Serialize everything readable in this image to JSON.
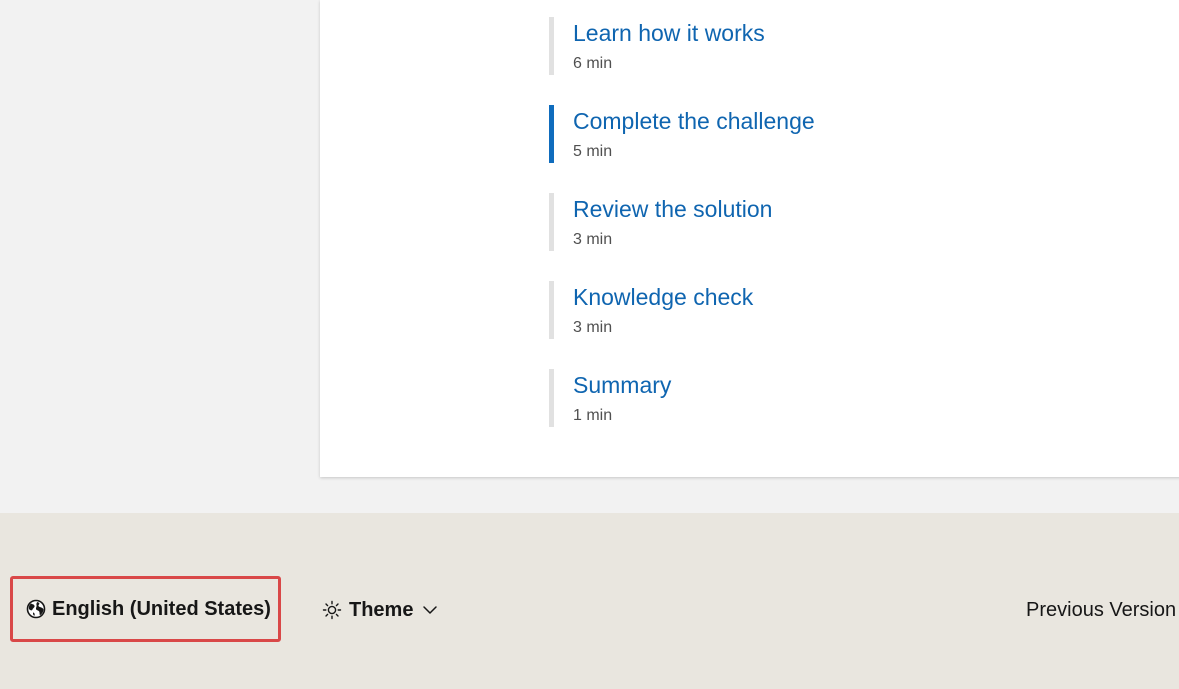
{
  "units": [
    {
      "title": "Learn how it works",
      "duration": "6 min",
      "active": false
    },
    {
      "title": "Complete the challenge",
      "duration": "5 min",
      "active": true
    },
    {
      "title": "Review the solution",
      "duration": "3 min",
      "active": false
    },
    {
      "title": "Knowledge check",
      "duration": "3 min",
      "active": false
    },
    {
      "title": "Summary",
      "duration": "1 min",
      "active": false
    }
  ],
  "footer": {
    "locale_label": "English (United States)",
    "locale_icon": "globe-icon",
    "theme_label": "Theme",
    "theme_icon": "sun-icon",
    "previous_versions_label": "Previous Version"
  },
  "colors": {
    "link": "#0f65b0",
    "active_bar": "#0f6cbd",
    "inactive_bar": "#e1e1e1",
    "highlight_border": "#d94848",
    "footer_bg": "#e9e6df",
    "page_bg": "#f2f2f2"
  }
}
